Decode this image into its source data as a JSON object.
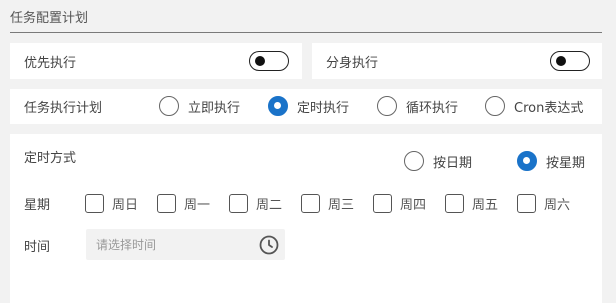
{
  "section": {
    "title": "任务配置计划"
  },
  "priority": {
    "label": "优先执行",
    "enabled": false
  },
  "split": {
    "label": "分身执行",
    "enabled": false
  },
  "plan": {
    "label": "任务执行计划",
    "options": [
      "立即执行",
      "定时执行",
      "循环执行",
      "Cron表达式"
    ],
    "selected": "定时执行"
  },
  "timing": {
    "label": "定时方式",
    "options": [
      "按日期",
      "按星期"
    ],
    "selected": "按星期"
  },
  "weekdays": {
    "label": "星期",
    "items": [
      "周日",
      "周一",
      "周二",
      "周三",
      "周四",
      "周五",
      "周六"
    ]
  },
  "time": {
    "label": "时间",
    "placeholder": "请选择时间",
    "icon": "clock-icon"
  },
  "colors": {
    "accent": "#1a73c9",
    "background": "#f2f2f2",
    "card": "#ffffff"
  }
}
